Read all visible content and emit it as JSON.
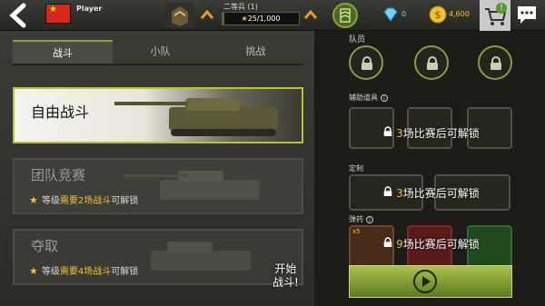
{
  "header": {
    "player_name": "Player",
    "rank_title": "二等兵 (1)",
    "xp_text": "25/1,000",
    "xp_progress": 0.025,
    "diamonds": "0",
    "coins": "4,600",
    "shop_badge": "!",
    "icons": {
      "back": "back-arrow-icon",
      "flag": "china-flag-icon",
      "rank": "rank-insignia-icon",
      "medal": "medal-icon",
      "diamond": "diamond-icon",
      "coin": "coin-icon",
      "shop": "shopping-cart-icon",
      "chat": "chat-icon"
    }
  },
  "tabs": [
    {
      "label": "战斗",
      "active": true
    },
    {
      "label": "小队",
      "active": false
    },
    {
      "label": "挑战",
      "active": false
    }
  ],
  "modes": [
    {
      "title": "自由战斗",
      "selected": true,
      "locked": false
    },
    {
      "title": "团队竞赛",
      "locked": true,
      "lock_prefix": "等级",
      "lock_highlight": "需要2场战斗",
      "lock_suffix": "可解锁"
    },
    {
      "title": "夺取",
      "locked": true,
      "lock_prefix": "等级",
      "lock_highlight": "需要4场战斗",
      "lock_suffix": "可解锁"
    }
  ],
  "start_hint": {
    "line1": "开始",
    "line2": "战斗!"
  },
  "right": {
    "crew_label": "队员",
    "aux_label": "辅助道具",
    "custom_label": "定制",
    "ammo_label": "弹药",
    "aux_lock": {
      "count": "3",
      "text": "场比赛后可解锁"
    },
    "custom_lock": {
      "count": "3",
      "text": "场比赛后可解锁"
    },
    "ammo_lock": {
      "count": "9",
      "text": "场比赛后可解锁"
    },
    "ammo_badge": "x5",
    "play_icon": "play-icon"
  },
  "colors": {
    "accent": "#b7c437",
    "gold": "#f2c230",
    "diamond": "#6fd4ff"
  }
}
